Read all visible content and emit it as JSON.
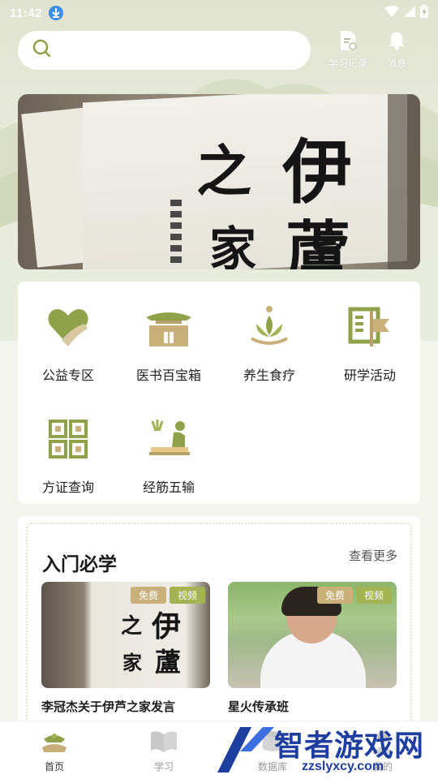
{
  "status_bar": {
    "time": "11:42"
  },
  "search": {
    "placeholder": ""
  },
  "top_actions": {
    "study_record": "学习记录",
    "messages": "消息"
  },
  "banner": {
    "calligraphy": [
      "之",
      "伊",
      "家",
      "蘆"
    ]
  },
  "quick_menu": [
    {
      "label": "公益专区",
      "icon": "heart-hand-icon"
    },
    {
      "label": "医书百宝箱",
      "icon": "pavilion-icon"
    },
    {
      "label": "养生食疗",
      "icon": "lotus-icon"
    },
    {
      "label": "研学活动",
      "icon": "book-flag-icon"
    },
    {
      "label": "方证查询",
      "icon": "grid-squares-icon"
    },
    {
      "label": "经筋五输",
      "icon": "massage-icon"
    }
  ],
  "intro_section": {
    "title": "入门必学",
    "more_label": "查看更多",
    "courses": [
      {
        "title": "李冠杰关于伊芦之家发言",
        "tags": [
          "免费",
          "视频"
        ]
      },
      {
        "title": "星火传承班",
        "tags": [
          "免费",
          "视频"
        ]
      }
    ]
  },
  "tabbar": {
    "items": [
      {
        "label": "首页",
        "icon": "home-hands-icon",
        "active": true
      },
      {
        "label": "学习",
        "icon": "open-book-icon",
        "active": false
      },
      {
        "label": "数据库",
        "icon": "database-icon",
        "active": false
      },
      {
        "label": "我的",
        "icon": "profile-icon",
        "active": false
      }
    ]
  },
  "watermark": {
    "brand": "智者游戏网",
    "domain": "zzslyxcy.com"
  },
  "colors": {
    "accent_green": "#8fa24a",
    "accent_tan": "#b8a16a",
    "tag_free": "#c9b07a",
    "tag_video": "#a3b253",
    "watermark_blue": "#1e3fa0"
  }
}
